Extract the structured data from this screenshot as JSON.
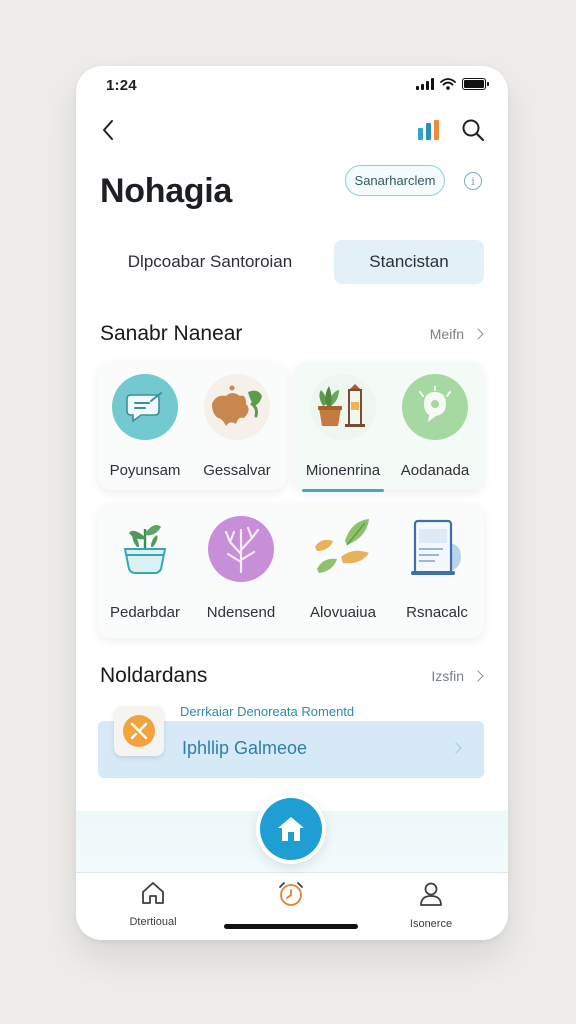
{
  "status_bar": {
    "time": "1:24",
    "signal_icon": "cellular-signal-icon",
    "wifi_icon": "wifi-icon",
    "battery_icon": "battery-full-icon"
  },
  "nav": {
    "back_icon": "chevron-left-icon",
    "chart_icon": "bar-chart-icon",
    "search_icon": "search-icon"
  },
  "header": {
    "title": "Nohagia",
    "pill_label": "Sanarharclem",
    "info_icon": "info-icon"
  },
  "segments": [
    {
      "label": "Dlpcoabar Santoroian",
      "selected": false
    },
    {
      "label": "Stancistan",
      "selected": true
    }
  ],
  "section_one": {
    "title": "Sanabr Nanear",
    "link": "Meifn",
    "row1": [
      {
        "label": "Poyunsam",
        "icon": "chat-bubble-icon"
      },
      {
        "label": "Gessalvar",
        "icon": "map-icon"
      },
      {
        "label": "Mionenrina",
        "icon": "potted-plant-stand-icon"
      },
      {
        "label": "Aodanada",
        "icon": "message-alert-icon"
      }
    ],
    "row2": [
      {
        "label": "Pedarbdar",
        "icon": "plant-pot-icon"
      },
      {
        "label": "Ndensend",
        "icon": "coral-tree-icon"
      },
      {
        "label": "Alovuaiua",
        "icon": "leaves-icon"
      },
      {
        "label": "Rsnacalc",
        "icon": "document-tablet-icon"
      }
    ]
  },
  "section_two": {
    "title": "Noldardans",
    "link": "Izsfin",
    "recent_caption": "Derrkaiar Denoreata Romentd",
    "recent_label": "Iphllip Galmeoe",
    "recent_icon": "compass-badge-icon"
  },
  "fab_icon": "home-icon",
  "tabs": [
    {
      "label": "Dtertioual",
      "icon": "house-outline-icon"
    },
    {
      "label": "",
      "icon": "alarm-clock-icon"
    },
    {
      "label": "Isonerce",
      "icon": "person-icon"
    }
  ],
  "colors": {
    "accent_blue": "#1f9ed3",
    "pill_border": "#8fd0d8",
    "segment_bg": "#e3f0f8",
    "recent_bg": "#d5e9f6"
  }
}
